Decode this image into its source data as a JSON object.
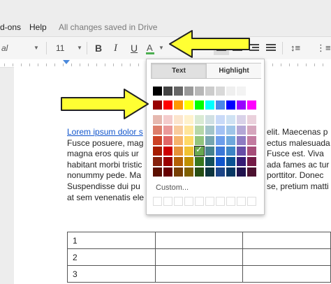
{
  "menu": {
    "addons": "d-ons",
    "help": "Help",
    "status": "All changes saved in Drive"
  },
  "toolbar": {
    "font": "al",
    "font_size": "11",
    "bold": "B",
    "italic": "I",
    "underline": "U",
    "text_color": "A",
    "text_color_current": "#4caf50",
    "caret": "▼"
  },
  "icons": {
    "highlight": "highlight-pen-icon",
    "line_spacing": "line-spacing-icon",
    "list": "numbered-list-icon"
  },
  "document": {
    "link_text": "Lorem ipsum dolor s",
    "lines": [
      "Fusce posuere, mag",
      "magna eros quis ur",
      "habitant morbi tristic",
      "nonummy pede. Ma",
      "Suspendisse dui pu",
      "at sem venenatis ele"
    ],
    "right_lines": [
      "elit. Maecenas p",
      "ectus malesuada",
      "Fusce est. Viva",
      "ada fames ac tur",
      "porttitor. Donec",
      "se, pretium matti",
      ""
    ],
    "table_rows": [
      "1",
      "2",
      "3"
    ]
  },
  "palette": {
    "tab_text": "Text",
    "tab_highlight": "Highlight",
    "custom_label": "Custom...",
    "gray_row": [
      "#000000",
      "#434343",
      "#666666",
      "#999999",
      "#b7b7b7",
      "#cccccc",
      "#d9d9d9",
      "#efefef",
      "#f3f3f3",
      "#ffffff"
    ],
    "bright_row": [
      "#980000",
      "#ff0000",
      "#ff9900",
      "#ffff00",
      "#00ff00",
      "#00ffff",
      "#4a86e8",
      "#0000ff",
      "#9900ff",
      "#ff00ff"
    ],
    "shades": [
      [
        "#e6b8af",
        "#f4cccc",
        "#fce5cd",
        "#fff2cc",
        "#d9ead3",
        "#d0e0e3",
        "#c9daf8",
        "#cfe2f3",
        "#d9d2e9",
        "#ead1dc"
      ],
      [
        "#dd7e6b",
        "#ea9999",
        "#f9cb9c",
        "#ffe599",
        "#b6d7a8",
        "#a2c4c9",
        "#a4c2f4",
        "#9fc5e8",
        "#b4a7d6",
        "#d5a6bd"
      ],
      [
        "#cc4125",
        "#e06666",
        "#f6b26b",
        "#ffd966",
        "#93c47d",
        "#76a5af",
        "#6d9eeb",
        "#6fa8dc",
        "#8e7cc3",
        "#c27ba0"
      ],
      [
        "#a61c00",
        "#cc0000",
        "#e69138",
        "#f1c232",
        "#6aa84f",
        "#45818e",
        "#3c78d8",
        "#3d85c6",
        "#674ea7",
        "#a64d79"
      ],
      [
        "#85200c",
        "#990000",
        "#b45f06",
        "#bf9000",
        "#38761d",
        "#134f5c",
        "#1155cc",
        "#0b5394",
        "#351c75",
        "#741b47"
      ],
      [
        "#5b0f00",
        "#660000",
        "#783f04",
        "#7f6000",
        "#274e13",
        "#0c343d",
        "#1c4587",
        "#073763",
        "#20124d",
        "#4c1130"
      ]
    ],
    "selected": {
      "row": 3,
      "col": 4
    }
  },
  "arrow_color": "#ffff33"
}
